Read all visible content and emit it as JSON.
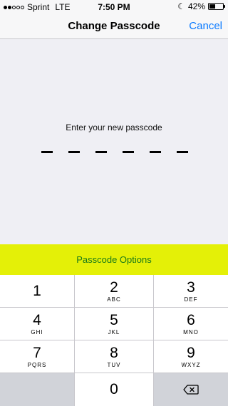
{
  "status_bar": {
    "carrier": "Sprint",
    "network": "LTE",
    "time": "7:50 PM",
    "battery_percent": "42%",
    "battery_level": 0.42
  },
  "nav": {
    "title": "Change Passcode",
    "cancel_label": "Cancel"
  },
  "prompt": "Enter your new passcode",
  "passcode_length": 6,
  "options_label": "Passcode Options",
  "colors": {
    "accent": "#0a7aff",
    "options_bg": "#e4f007",
    "options_text": "#1a7a1a"
  },
  "keypad": {
    "keys": [
      {
        "digit": "1",
        "letters": ""
      },
      {
        "digit": "2",
        "letters": "ABC"
      },
      {
        "digit": "3",
        "letters": "DEF"
      },
      {
        "digit": "4",
        "letters": "GHI"
      },
      {
        "digit": "5",
        "letters": "JKL"
      },
      {
        "digit": "6",
        "letters": "MNO"
      },
      {
        "digit": "7",
        "letters": "PQRS"
      },
      {
        "digit": "8",
        "letters": "TUV"
      },
      {
        "digit": "9",
        "letters": "WXYZ"
      }
    ],
    "zero": {
      "digit": "0",
      "letters": ""
    },
    "delete_icon": "backspace-icon"
  }
}
